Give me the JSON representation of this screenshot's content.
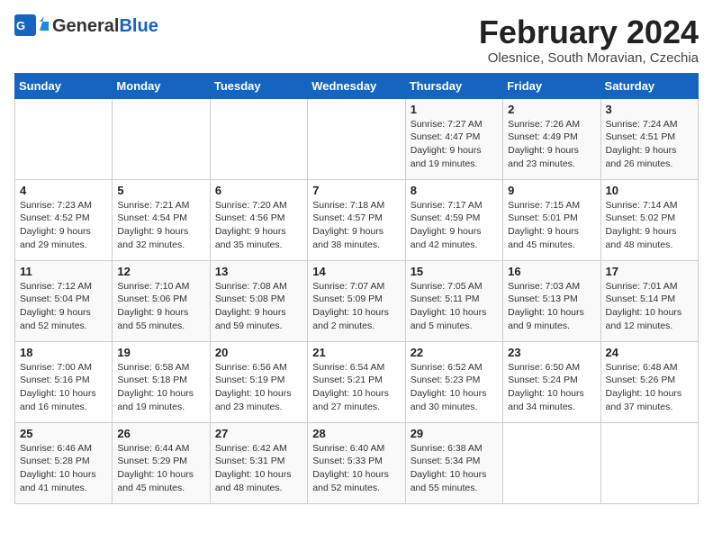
{
  "logo": {
    "general": "General",
    "blue": "Blue"
  },
  "title": {
    "month_year": "February 2024",
    "location": "Olesnice, South Moravian, Czechia"
  },
  "days_of_week": [
    "Sunday",
    "Monday",
    "Tuesday",
    "Wednesday",
    "Thursday",
    "Friday",
    "Saturday"
  ],
  "weeks": [
    [
      {
        "day": "",
        "info": ""
      },
      {
        "day": "",
        "info": ""
      },
      {
        "day": "",
        "info": ""
      },
      {
        "day": "",
        "info": ""
      },
      {
        "day": "1",
        "info": "Sunrise: 7:27 AM\nSunset: 4:47 PM\nDaylight: 9 hours\nand 19 minutes."
      },
      {
        "day": "2",
        "info": "Sunrise: 7:26 AM\nSunset: 4:49 PM\nDaylight: 9 hours\nand 23 minutes."
      },
      {
        "day": "3",
        "info": "Sunrise: 7:24 AM\nSunset: 4:51 PM\nDaylight: 9 hours\nand 26 minutes."
      }
    ],
    [
      {
        "day": "4",
        "info": "Sunrise: 7:23 AM\nSunset: 4:52 PM\nDaylight: 9 hours\nand 29 minutes."
      },
      {
        "day": "5",
        "info": "Sunrise: 7:21 AM\nSunset: 4:54 PM\nDaylight: 9 hours\nand 32 minutes."
      },
      {
        "day": "6",
        "info": "Sunrise: 7:20 AM\nSunset: 4:56 PM\nDaylight: 9 hours\nand 35 minutes."
      },
      {
        "day": "7",
        "info": "Sunrise: 7:18 AM\nSunset: 4:57 PM\nDaylight: 9 hours\nand 38 minutes."
      },
      {
        "day": "8",
        "info": "Sunrise: 7:17 AM\nSunset: 4:59 PM\nDaylight: 9 hours\nand 42 minutes."
      },
      {
        "day": "9",
        "info": "Sunrise: 7:15 AM\nSunset: 5:01 PM\nDaylight: 9 hours\nand 45 minutes."
      },
      {
        "day": "10",
        "info": "Sunrise: 7:14 AM\nSunset: 5:02 PM\nDaylight: 9 hours\nand 48 minutes."
      }
    ],
    [
      {
        "day": "11",
        "info": "Sunrise: 7:12 AM\nSunset: 5:04 PM\nDaylight: 9 hours\nand 52 minutes."
      },
      {
        "day": "12",
        "info": "Sunrise: 7:10 AM\nSunset: 5:06 PM\nDaylight: 9 hours\nand 55 minutes."
      },
      {
        "day": "13",
        "info": "Sunrise: 7:08 AM\nSunset: 5:08 PM\nDaylight: 9 hours\nand 59 minutes."
      },
      {
        "day": "14",
        "info": "Sunrise: 7:07 AM\nSunset: 5:09 PM\nDaylight: 10 hours\nand 2 minutes."
      },
      {
        "day": "15",
        "info": "Sunrise: 7:05 AM\nSunset: 5:11 PM\nDaylight: 10 hours\nand 5 minutes."
      },
      {
        "day": "16",
        "info": "Sunrise: 7:03 AM\nSunset: 5:13 PM\nDaylight: 10 hours\nand 9 minutes."
      },
      {
        "day": "17",
        "info": "Sunrise: 7:01 AM\nSunset: 5:14 PM\nDaylight: 10 hours\nand 12 minutes."
      }
    ],
    [
      {
        "day": "18",
        "info": "Sunrise: 7:00 AM\nSunset: 5:16 PM\nDaylight: 10 hours\nand 16 minutes."
      },
      {
        "day": "19",
        "info": "Sunrise: 6:58 AM\nSunset: 5:18 PM\nDaylight: 10 hours\nand 19 minutes."
      },
      {
        "day": "20",
        "info": "Sunrise: 6:56 AM\nSunset: 5:19 PM\nDaylight: 10 hours\nand 23 minutes."
      },
      {
        "day": "21",
        "info": "Sunrise: 6:54 AM\nSunset: 5:21 PM\nDaylight: 10 hours\nand 27 minutes."
      },
      {
        "day": "22",
        "info": "Sunrise: 6:52 AM\nSunset: 5:23 PM\nDaylight: 10 hours\nand 30 minutes."
      },
      {
        "day": "23",
        "info": "Sunrise: 6:50 AM\nSunset: 5:24 PM\nDaylight: 10 hours\nand 34 minutes."
      },
      {
        "day": "24",
        "info": "Sunrise: 6:48 AM\nSunset: 5:26 PM\nDaylight: 10 hours\nand 37 minutes."
      }
    ],
    [
      {
        "day": "25",
        "info": "Sunrise: 6:46 AM\nSunset: 5:28 PM\nDaylight: 10 hours\nand 41 minutes."
      },
      {
        "day": "26",
        "info": "Sunrise: 6:44 AM\nSunset: 5:29 PM\nDaylight: 10 hours\nand 45 minutes."
      },
      {
        "day": "27",
        "info": "Sunrise: 6:42 AM\nSunset: 5:31 PM\nDaylight: 10 hours\nand 48 minutes."
      },
      {
        "day": "28",
        "info": "Sunrise: 6:40 AM\nSunset: 5:33 PM\nDaylight: 10 hours\nand 52 minutes."
      },
      {
        "day": "29",
        "info": "Sunrise: 6:38 AM\nSunset: 5:34 PM\nDaylight: 10 hours\nand 55 minutes."
      },
      {
        "day": "",
        "info": ""
      },
      {
        "day": "",
        "info": ""
      }
    ]
  ]
}
